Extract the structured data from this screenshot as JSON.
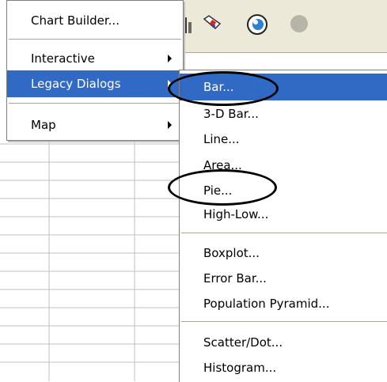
{
  "graphs_menu": {
    "items": [
      {
        "label": "Chart Builder...",
        "has_submenu": false
      },
      {
        "label": "Interactive",
        "has_submenu": true
      },
      {
        "label": "Legacy Dialogs",
        "has_submenu": true,
        "selected": true
      },
      {
        "label": "Map",
        "has_submenu": true
      }
    ]
  },
  "legacy_dialogs_menu": {
    "items": [
      {
        "label": "Bar...",
        "selected": true,
        "circled": true
      },
      {
        "label": "3-D Bar..."
      },
      {
        "label": "Line..."
      },
      {
        "label": "Area..."
      },
      {
        "label": "Pie...",
        "circled": true
      },
      {
        "label": "High-Low..."
      },
      {
        "label": "Boxplot..."
      },
      {
        "label": "Error Bar..."
      },
      {
        "label": "Population Pyramid..."
      },
      {
        "label": "Scatter/Dot..."
      },
      {
        "label": "Histogram..."
      }
    ]
  },
  "colors": {
    "selection": "#316ac5",
    "menu_bg": "#ffffff",
    "toolbar_bg": "#ece9d8"
  },
  "toolbar": {
    "icons": [
      "chart-icon",
      "paint-icon",
      "circle-icon",
      "disabled-circle-icon"
    ]
  }
}
